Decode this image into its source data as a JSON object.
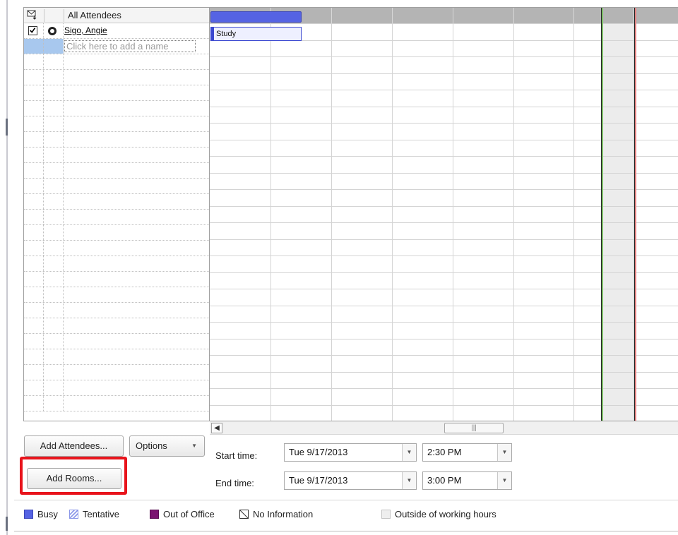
{
  "attendees": {
    "header_title": "All Attendees",
    "rows": [
      {
        "name": "Sigo, Angie",
        "checked": true
      },
      {
        "add_placeholder": "Click here to add a name"
      }
    ]
  },
  "schedule": {
    "busy_label": "Study"
  },
  "buttons": {
    "add_attendees": "Add Attendees...",
    "options": "Options",
    "add_rooms": "Add Rooms..."
  },
  "times": {
    "start_label": "Start time:",
    "end_label": "End time:",
    "start_date": "Tue 9/17/2013",
    "start_time": "2:30 PM",
    "end_date": "Tue 9/17/2013",
    "end_time": "3:00 PM"
  },
  "legend": {
    "busy": "Busy",
    "tentative": "Tentative",
    "out_of_office": "Out of Office",
    "no_information": "No Information",
    "outside_hours": "Outside of working hours"
  },
  "colors": {
    "busy": "#5563e3",
    "out_of_office": "#7a1270",
    "meeting_start": "#7fc06a",
    "meeting_end": "#e08080",
    "highlight": "#e8141c"
  }
}
